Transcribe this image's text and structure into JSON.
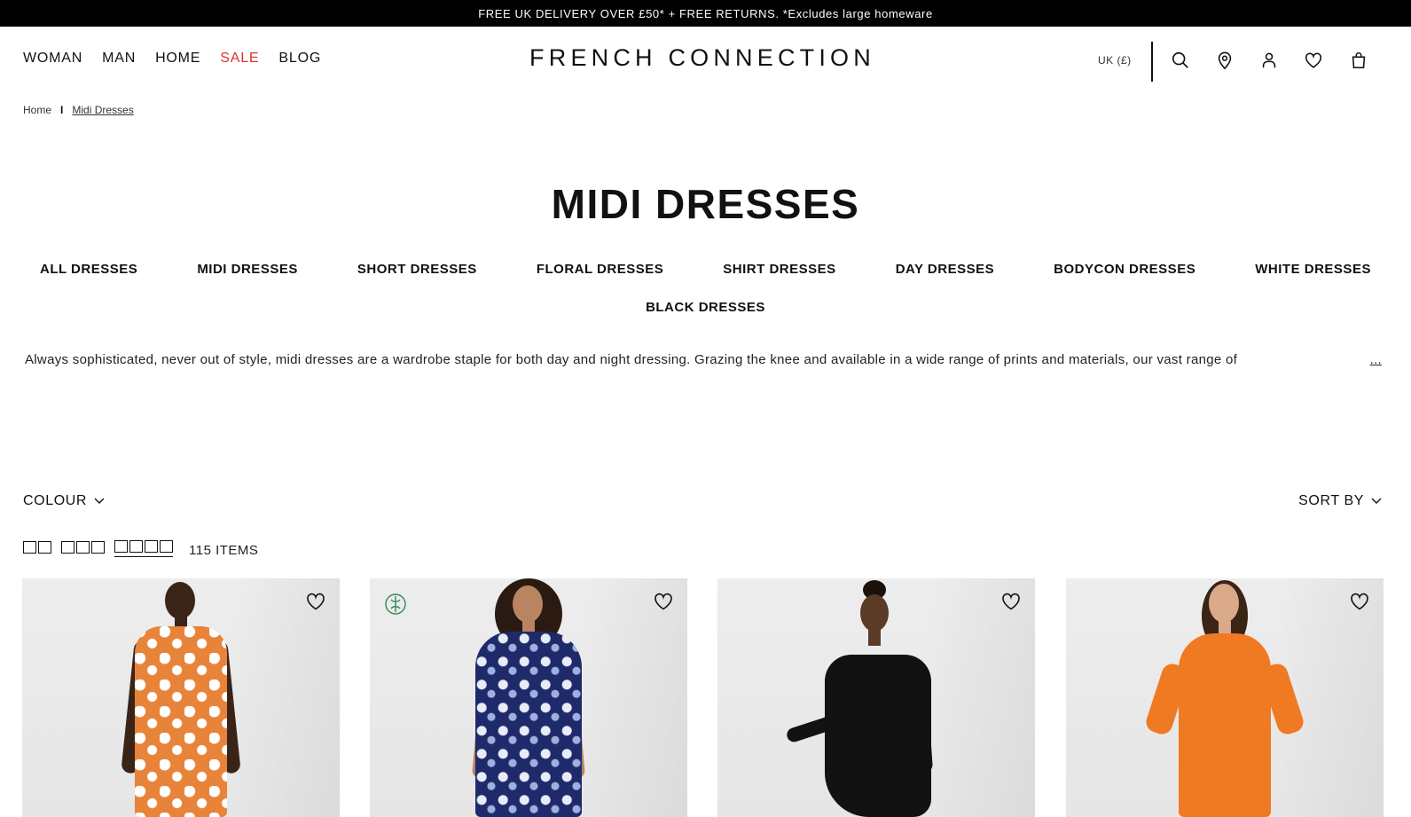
{
  "promo": {
    "text": "FREE UK DELIVERY OVER £50* + FREE RETURNS. *Excludes large homeware"
  },
  "nav": {
    "items": [
      {
        "label": "WOMAN"
      },
      {
        "label": "MAN"
      },
      {
        "label": "HOME"
      },
      {
        "label": "SALE"
      },
      {
        "label": "BLOG"
      }
    ]
  },
  "brand": {
    "logo": "FRENCH CONNECTION"
  },
  "header": {
    "currency": "UK (£)",
    "icons": [
      "search-icon",
      "store-locator-icon",
      "account-icon",
      "wishlist-icon",
      "bag-icon"
    ]
  },
  "breadcrumb": {
    "home": "Home",
    "separator": "I",
    "current": "Midi Dresses"
  },
  "page": {
    "title": "MIDI DRESSES"
  },
  "categories": [
    {
      "label": "ALL DRESSES"
    },
    {
      "label": "MIDI DRESSES"
    },
    {
      "label": "SHORT DRESSES"
    },
    {
      "label": "FLORAL DRESSES"
    },
    {
      "label": "SHIRT DRESSES"
    },
    {
      "label": "DAY DRESSES"
    },
    {
      "label": "BODYCON DRESSES"
    },
    {
      "label": "WHITE DRESSES"
    },
    {
      "label": "BLACK DRESSES"
    }
  ],
  "description": {
    "text": "Always sophisticated, never out of style, midi dresses are a wardrobe staple for both day and night dressing. Grazing the knee and available in a wide range of prints and materials, our vast range of",
    "more": "..."
  },
  "toolbar": {
    "filter_label": "COLOUR",
    "sort_label": "SORT BY",
    "items_count": "115 ITEMS",
    "grid_options": [
      "2-column",
      "3-column",
      "4-column"
    ],
    "active_grid": "4-column"
  },
  "products": [
    {
      "dress_color": "#e8833a",
      "pattern": "orange-white-print",
      "eco": false
    },
    {
      "dress_color": "#1f2a6b",
      "pattern": "navy-white-print",
      "eco": true
    },
    {
      "dress_color": "#121212",
      "pattern": "solid-black",
      "eco": false
    },
    {
      "dress_color": "#f07a22",
      "pattern": "solid-orange",
      "eco": false
    }
  ],
  "colors": {
    "sale": "#e0312b",
    "eco_badge": "#2e8b57",
    "promo_bg": "#000000"
  }
}
